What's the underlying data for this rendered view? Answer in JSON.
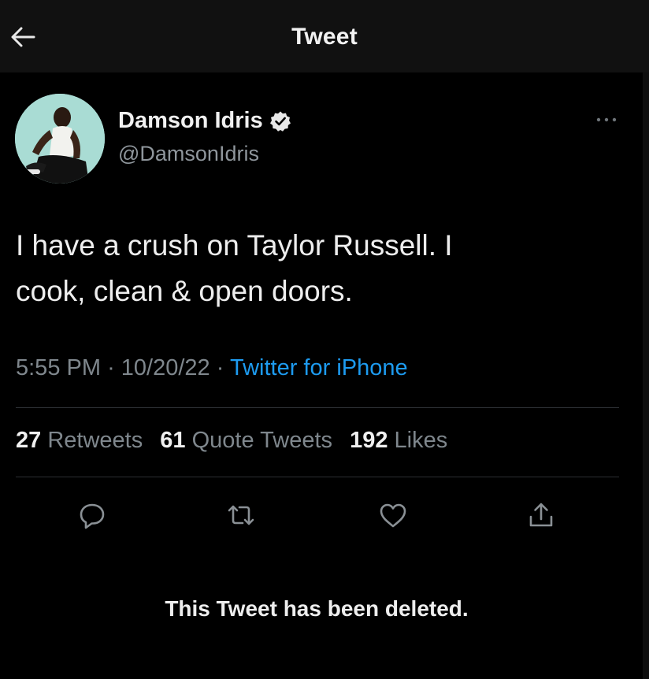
{
  "header": {
    "title": "Tweet",
    "back_icon": "arrow-left-icon"
  },
  "tweet": {
    "author": {
      "display_name": "Damson Idris",
      "handle": "@DamsonIdris",
      "verified": true
    },
    "text_line1": "I have a crush on Taylor Russell. I",
    "text_line2": "cook, clean & open doors.",
    "time": "5:55 PM",
    "date": "10/20/22",
    "separator": "·",
    "source": "Twitter for iPhone",
    "stats": {
      "retweets_count": "27",
      "retweets_label": "Retweets",
      "quotes_count": "61",
      "quotes_label": "Quote Tweets",
      "likes_count": "192",
      "likes_label": "Likes"
    },
    "actions": [
      "reply-icon",
      "retweet-icon",
      "like-icon",
      "share-icon"
    ]
  },
  "footer": {
    "deleted_notice": "This Tweet has been deleted."
  },
  "colors": {
    "background": "#000000",
    "header_bg": "#111111",
    "text_primary": "#eeeeee",
    "text_secondary": "#7f878d",
    "accent_link": "#1d9bf0",
    "divider": "#2c2f33",
    "avatar_bg": "#a9dcd4"
  }
}
